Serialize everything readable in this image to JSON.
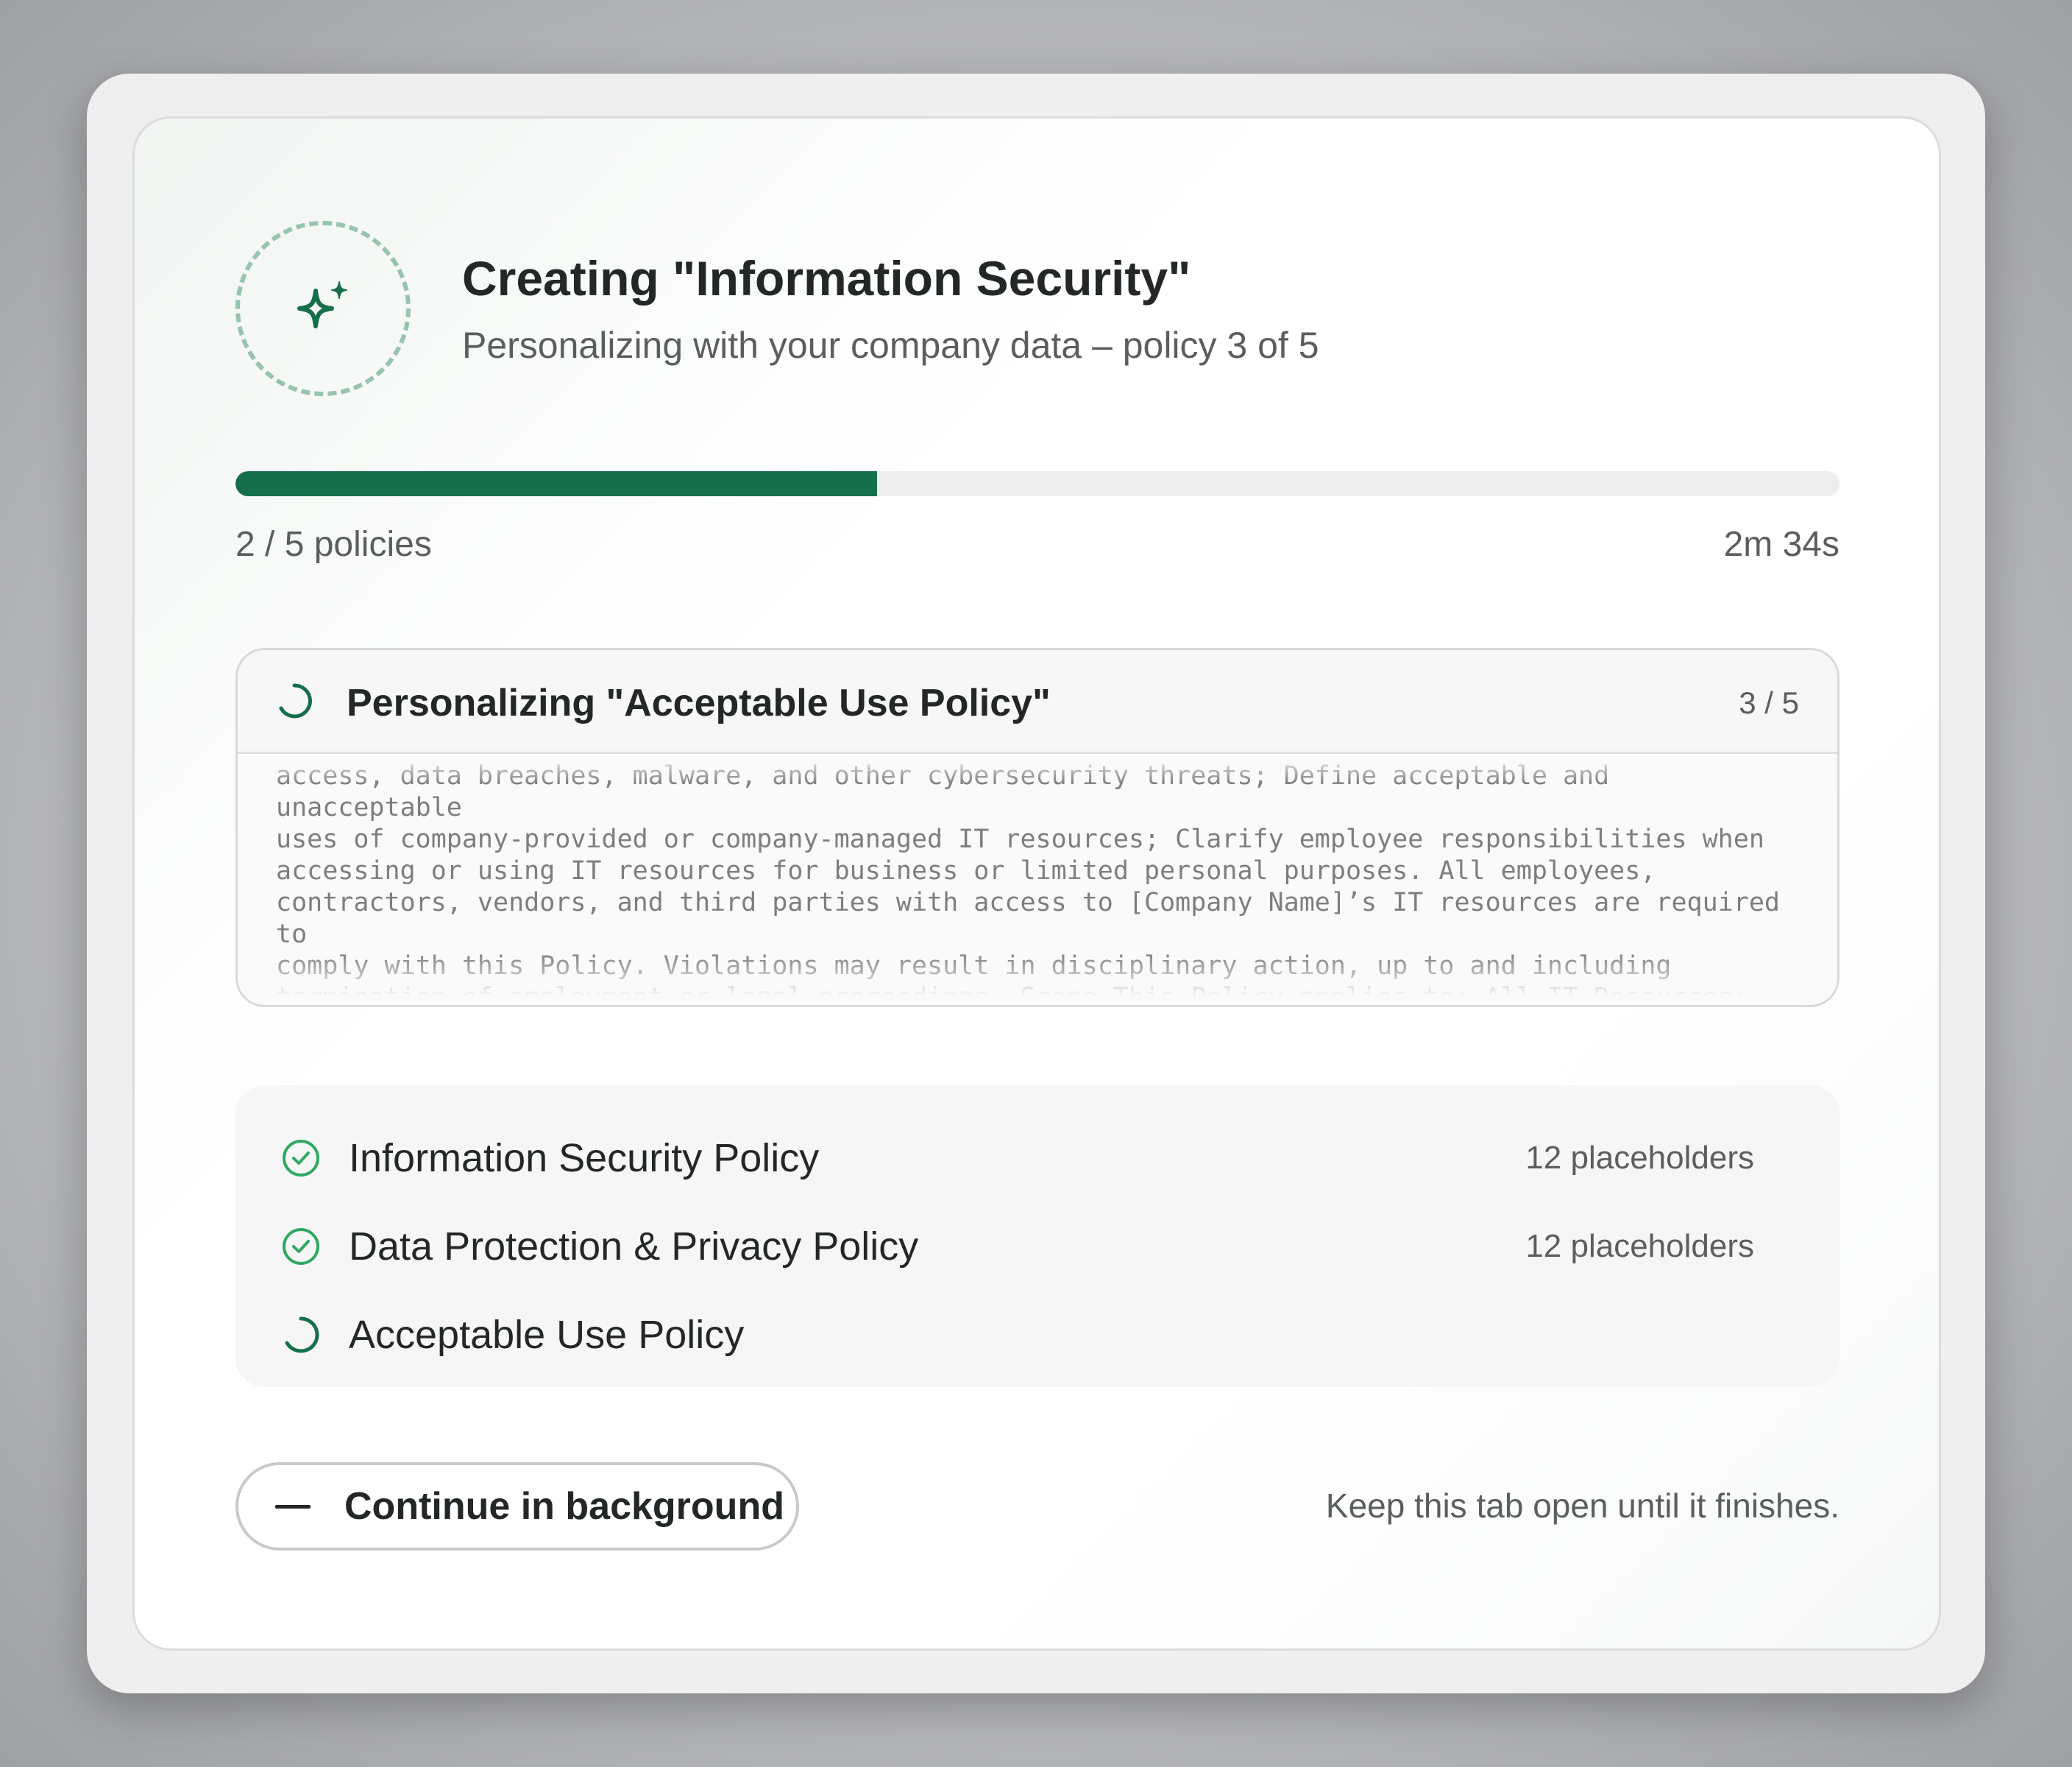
{
  "dialog": {
    "title": "Creating \"Information Security\"",
    "subtitle": "Personalizing with your company data – policy 3 of 5",
    "badge_icon": "sparkle-icon"
  },
  "progress": {
    "completed_label": "2 / 5 policies",
    "elapsed": "2m 34s",
    "fraction": 0.4,
    "color": "#156f4a"
  },
  "active": {
    "title": "Personalizing \"Acceptable Use Policy\"",
    "count": "3 / 5",
    "stream_text": "access, data breaches, malware, and other cybersecurity threats; Define acceptable and unacceptable\nuses of company-provided or company-managed IT resources; Clarify employee responsibilities when\naccessing or using IT resources for business or limited personal purposes. All employees,\ncontractors, vendors, and third parties with access to [Company Name]’s IT resources are required to\ncomply with this Policy. Violations may result in disciplinary action, up to and including\ntermination of employment or legal proceedings. Scope This Policy applies to: All IT Resources: Any\ndevice, system, network, application, or service owned, leased, licensed, or managed by [Company"
  },
  "policies": [
    {
      "name": "Information Security Policy",
      "meta": "12 placeholders",
      "status": "done"
    },
    {
      "name": "Data Protection & Privacy Policy",
      "meta": "12 placeholders",
      "status": "done"
    },
    {
      "name": "Acceptable Use Policy",
      "meta": "",
      "status": "in-progress"
    }
  ],
  "footer": {
    "button_label": "Continue in background",
    "hint": "Keep this tab open until it finishes."
  },
  "colors": {
    "accent": "#156f4a",
    "check": "#2fa862"
  }
}
